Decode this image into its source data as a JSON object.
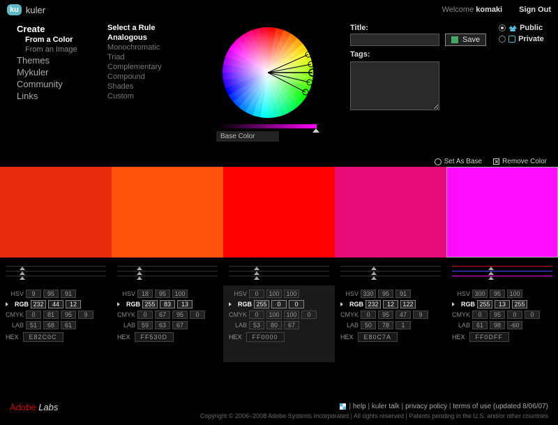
{
  "header": {
    "logo_badge": "ku",
    "logo_text": "kuler",
    "welcome_prefix": "Welcome ",
    "username": "komaki",
    "signout": "Sign Out"
  },
  "nav": {
    "create": "Create",
    "from_color": "From a Color",
    "from_image": "From an Image",
    "themes": "Themes",
    "mykuler": "Mykuler",
    "community": "Community",
    "links": "Links"
  },
  "rules": {
    "header": "Select a Rule",
    "items": [
      "Analogous",
      "Monochromatic",
      "Triad",
      "Complementary",
      "Compound",
      "Shades",
      "Custom"
    ],
    "active_index": 0
  },
  "wheel": {
    "base_color_label": "Base Color"
  },
  "form": {
    "title_label": "Title:",
    "tags_label": "Tags:",
    "save": "Save",
    "public": "Public",
    "private": "Private",
    "visibility": "public"
  },
  "swatch_controls": {
    "set_as_base": "Set As Base",
    "remove_color": "Remove Color"
  },
  "swatches": [
    {
      "hex": "#E82C0C"
    },
    {
      "hex": "#FF530D"
    },
    {
      "hex": "#FF0000"
    },
    {
      "hex": "#E80C7A"
    },
    {
      "hex": "#FF0DFF"
    }
  ],
  "selected_swatch_index": 4,
  "base_swatch_index": 2,
  "color_models": {
    "labels": {
      "hsv": "HSV",
      "rgb": "RGB",
      "cmyk": "CMYK",
      "lab": "LAB",
      "hex": "HEX"
    },
    "columns": [
      {
        "hsv": [
          "9",
          "95",
          "91"
        ],
        "rgb": [
          "232",
          "44",
          "12"
        ],
        "cmyk": [
          "0",
          "81",
          "95",
          "9"
        ],
        "lab": [
          "51",
          "68",
          "61"
        ],
        "hex": "E82C0C"
      },
      {
        "hsv": [
          "18",
          "95",
          "100"
        ],
        "rgb": [
          "255",
          "83",
          "13"
        ],
        "cmyk": [
          "0",
          "67",
          "95",
          "0"
        ],
        "lab": [
          "59",
          "63",
          "67"
        ],
        "hex": "FF530D"
      },
      {
        "hsv": [
          "0",
          "100",
          "100"
        ],
        "rgb": [
          "255",
          "0",
          "0"
        ],
        "cmyk": [
          "0",
          "100",
          "100",
          "0"
        ],
        "lab": [
          "53",
          "80",
          "67"
        ],
        "hex": "FF0000"
      },
      {
        "hsv": [
          "330",
          "95",
          "91"
        ],
        "rgb": [
          "232",
          "12",
          "122"
        ],
        "cmyk": [
          "0",
          "95",
          "47",
          "9"
        ],
        "lab": [
          "50",
          "78",
          "1"
        ],
        "hex": "E80C7A"
      },
      {
        "hsv": [
          "300",
          "95",
          "100"
        ],
        "rgb": [
          "255",
          "13",
          "255"
        ],
        "cmyk": [
          "0",
          "95",
          "0",
          "0"
        ],
        "lab": [
          "61",
          "98",
          "-60"
        ],
        "hex": "FF0DFF"
      }
    ]
  },
  "footer": {
    "brand_a": "Adobe ",
    "brand_l": "Labs",
    "links": [
      "help",
      "kuler talk",
      "privacy policy",
      "terms of use (updated 8/06/07)"
    ],
    "copyright": "Copyright © 2006–2008 Adobe Systems Incorporated | All rights reserved | Patents pending in the U.S. and/or other countries"
  }
}
